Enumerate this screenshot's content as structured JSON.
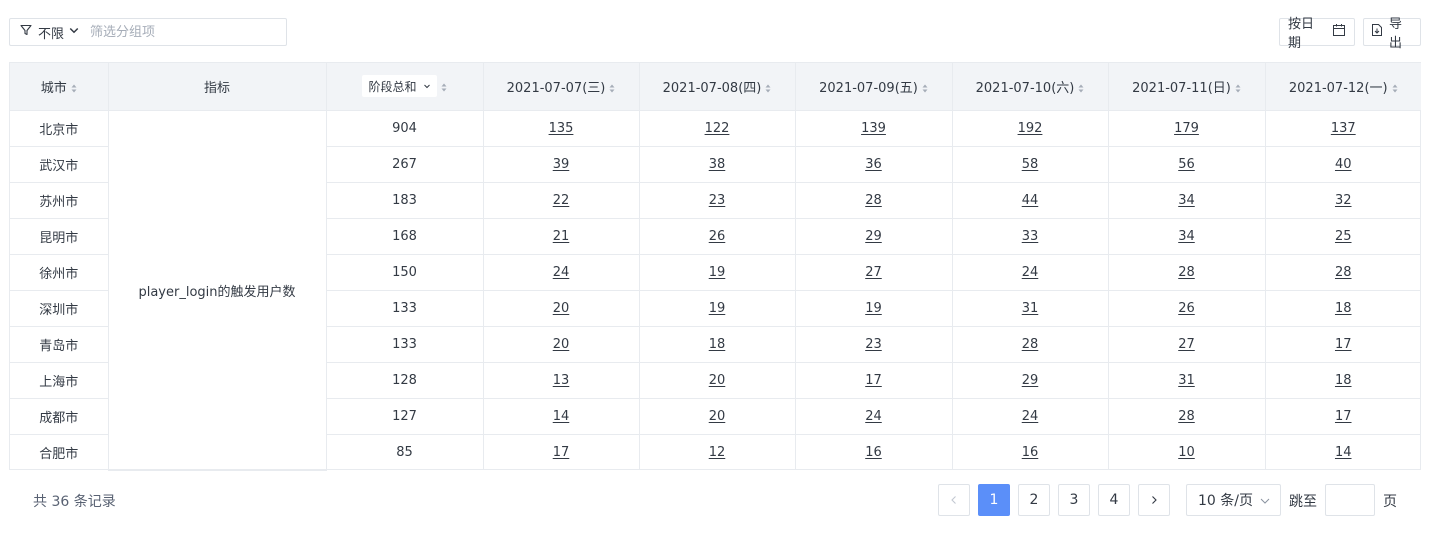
{
  "toolbar": {
    "filter_label": "不限",
    "filter_placeholder": "筛选分组项",
    "date_button": "按日期",
    "export_button": "导出"
  },
  "table": {
    "headers": {
      "city": "城市",
      "metric": "指标",
      "stage_total": "阶段总和",
      "dates": [
        "2021-07-07(三)",
        "2021-07-08(四)",
        "2021-07-09(五)",
        "2021-07-10(六)",
        "2021-07-11(日)",
        "2021-07-12(一)"
      ]
    },
    "metric_name": "player_login的触发用户数",
    "rows": [
      {
        "city": "北京市",
        "total": "904",
        "values": [
          "135",
          "122",
          "139",
          "192",
          "179",
          "137"
        ]
      },
      {
        "city": "武汉市",
        "total": "267",
        "values": [
          "39",
          "38",
          "36",
          "58",
          "56",
          "40"
        ]
      },
      {
        "city": "苏州市",
        "total": "183",
        "values": [
          "22",
          "23",
          "28",
          "44",
          "34",
          "32"
        ]
      },
      {
        "city": "昆明市",
        "total": "168",
        "values": [
          "21",
          "26",
          "29",
          "33",
          "34",
          "25"
        ]
      },
      {
        "city": "徐州市",
        "total": "150",
        "values": [
          "24",
          "19",
          "27",
          "24",
          "28",
          "28"
        ]
      },
      {
        "city": "深圳市",
        "total": "133",
        "values": [
          "20",
          "19",
          "19",
          "31",
          "26",
          "18"
        ]
      },
      {
        "city": "青岛市",
        "total": "133",
        "values": [
          "20",
          "18",
          "23",
          "28",
          "27",
          "17"
        ]
      },
      {
        "city": "上海市",
        "total": "128",
        "values": [
          "13",
          "20",
          "17",
          "29",
          "31",
          "18"
        ]
      },
      {
        "city": "成都市",
        "total": "127",
        "values": [
          "14",
          "20",
          "24",
          "24",
          "28",
          "17"
        ]
      },
      {
        "city": "合肥市",
        "total": "85",
        "values": [
          "17",
          "12",
          "16",
          "16",
          "10",
          "14"
        ]
      }
    ]
  },
  "footer": {
    "total_text": "共 36 条记录",
    "pages": [
      "1",
      "2",
      "3",
      "4"
    ],
    "current_page": "1",
    "page_size": "10 条/页",
    "jump_label": "跳至",
    "jump_suffix": "页"
  },
  "colors": {
    "accent": "#5b8ff9",
    "header_bg": "#f2f4f7",
    "border": "#e8ebef"
  },
  "icons": {
    "filter": "funnel-icon",
    "date": "calendar-icon",
    "export": "export-file-icon",
    "sort": "sort-icon",
    "prev": "chevron-left-icon",
    "next": "chevron-right-icon"
  }
}
